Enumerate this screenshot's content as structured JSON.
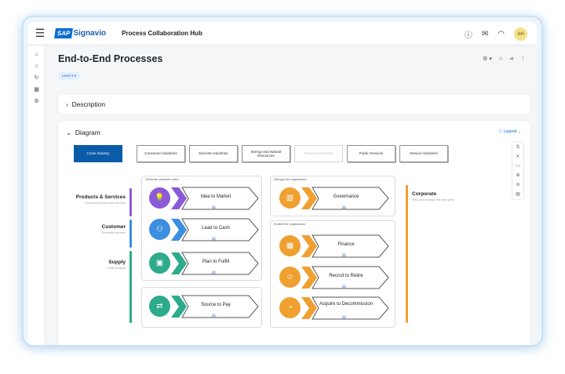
{
  "app": {
    "logo_sap": "SAP",
    "logo_name": "Signavio",
    "hub_title": "Process Collaboration Hub",
    "avatar_initials": "AH"
  },
  "page": {
    "title": "End-to-End Processes",
    "level_chip": "Level 1"
  },
  "sections": {
    "description": "Description",
    "diagram": "Diagram",
    "legend": "Legend"
  },
  "industries": [
    {
      "label": "Cross Industry",
      "selected": true
    },
    {
      "label": "Consumer Industries"
    },
    {
      "label": "Discrete Industries"
    },
    {
      "label": "Energy and Natural Resources"
    },
    {
      "label": "Financial Services",
      "disabled": true
    },
    {
      "label": "Public Services"
    },
    {
      "label": "Service Industries"
    }
  ],
  "rows": {
    "products": {
      "title": "Products & Services",
      "sub": "Develop products and services"
    },
    "customer": {
      "title": "Customer",
      "sub": "Generate demand"
    },
    "supply": {
      "title": "Supply",
      "sub": "Fulfill demand"
    },
    "corporate": {
      "title": "Corporate",
      "sub": "Plan and manage the enterprise"
    }
  },
  "groups": {
    "generate": "Generate customer value",
    "manage": "Manage the organization",
    "enable": "Enable the organization"
  },
  "processes": {
    "idea": "Idea to Market",
    "lead": "Lead to Cash",
    "plan": "Plan to Fulfill",
    "source": "Source to Pay",
    "governance": "Governance",
    "finance": "Finance",
    "recruit": "Recruit to Retire",
    "acquire": "Acquire to Decommission"
  },
  "colors": {
    "purple": "#8c5ad8",
    "blue": "#3c8fe0",
    "green": "#2dab8a",
    "orange": "#f0a030",
    "accent": "#0a6ed1"
  }
}
